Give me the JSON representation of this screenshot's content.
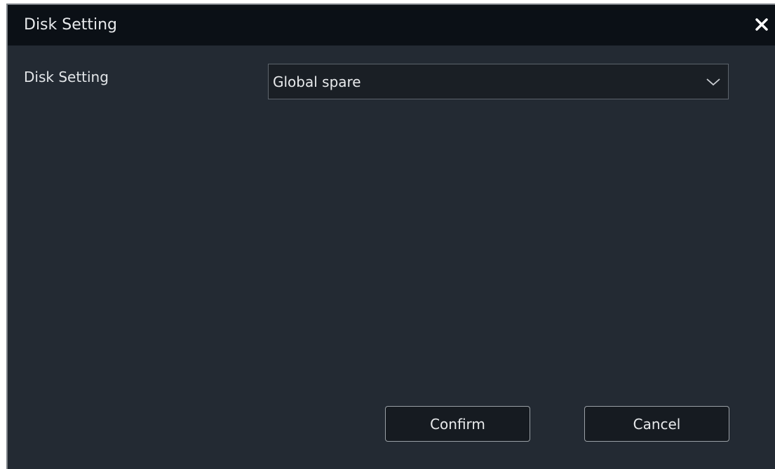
{
  "dialog": {
    "title": "Disk Setting",
    "close_icon": "close-icon"
  },
  "form": {
    "disk_setting_label": "Disk Setting",
    "disk_setting_value": "Global spare",
    "dropdown_icon": "chevron-down-icon"
  },
  "buttons": {
    "confirm_label": "Confirm",
    "cancel_label": "Cancel"
  },
  "colors": {
    "dialog_background": "#232a33",
    "titlebar_background": "#0b1016",
    "text": "#e8eaec",
    "button_border": "#9aa0a6"
  }
}
